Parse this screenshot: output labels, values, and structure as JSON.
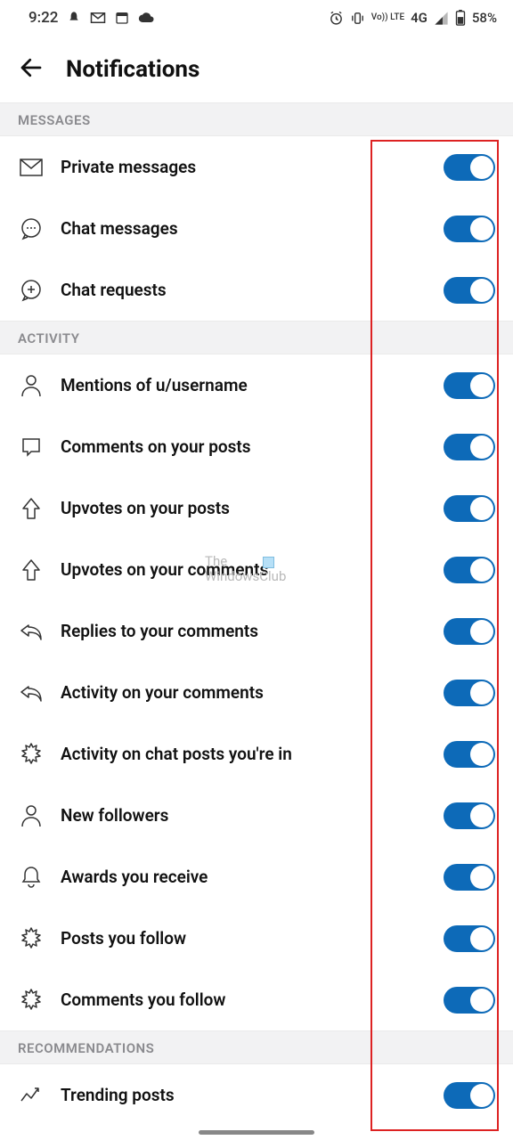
{
  "status": {
    "time": "9:22",
    "network_label": "4G",
    "lte_label": "Vo)) LTE",
    "battery_text": "58%"
  },
  "header": {
    "title": "Notifications"
  },
  "sections": [
    {
      "title": "MESSAGES",
      "items": [
        {
          "icon": "mail",
          "label": "Private messages",
          "on": true
        },
        {
          "icon": "chat",
          "label": "Chat messages",
          "on": true
        },
        {
          "icon": "chat-plus",
          "label": "Chat requests",
          "on": true
        }
      ]
    },
    {
      "title": "ACTIVITY",
      "items": [
        {
          "icon": "user",
          "label": "Mentions of u/username",
          "on": true
        },
        {
          "icon": "comment",
          "label": "Comments on your posts",
          "on": true
        },
        {
          "icon": "upvote",
          "label": "Upvotes on your posts",
          "on": true
        },
        {
          "icon": "upvote",
          "label": "Upvotes on your comments",
          "on": true
        },
        {
          "icon": "reply",
          "label": "Replies to your comments",
          "on": true
        },
        {
          "icon": "reply",
          "label": "Activity on your comments",
          "on": true
        },
        {
          "icon": "burst",
          "label": "Activity on chat posts you're in",
          "on": true
        },
        {
          "icon": "user",
          "label": "New followers",
          "on": true
        },
        {
          "icon": "bell",
          "label": "Awards you receive",
          "on": true
        },
        {
          "icon": "burst",
          "label": "Posts you follow",
          "on": true
        },
        {
          "icon": "burst",
          "label": "Comments you follow",
          "on": true
        }
      ]
    },
    {
      "title": "RECOMMENDATIONS",
      "items": [
        {
          "icon": "trend",
          "label": "Trending posts",
          "on": true
        }
      ]
    }
  ],
  "watermark": {
    "line1": "The",
    "line2": "WindowsClub"
  },
  "colors": {
    "toggle_on": "#0d6ab8",
    "section_bg": "#f2f2f3",
    "highlight_border": "#d22"
  }
}
